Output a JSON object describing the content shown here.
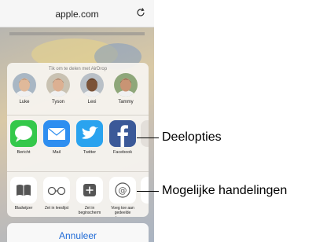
{
  "browser": {
    "url": "apple.com"
  },
  "share_sheet": {
    "airdrop_hint": "Tik om te delen met AirDrop",
    "people": [
      {
        "name": "Luke",
        "skin": "#e0b99a",
        "hair": "#6d4c36",
        "bg": "#a9b7c4"
      },
      {
        "name": "Tyson",
        "skin": "#dcb092",
        "hair": "#3c2e26",
        "bg": "#c9c2b2"
      },
      {
        "name": "Lexi",
        "skin": "#7b5338",
        "hair": "#1f1510",
        "bg": "#b9c0c7"
      },
      {
        "name": "Tammy",
        "skin": "#c99474",
        "hair": "#2c1d16",
        "bg": "#8fa77a"
      }
    ],
    "apps": [
      {
        "label": "Bericht",
        "icon": "messages-icon",
        "color": "#34c84a"
      },
      {
        "label": "Mail",
        "icon": "mail-icon",
        "color": "#2e8ef0"
      },
      {
        "label": "Twitter",
        "icon": "twitter-icon",
        "color": "#2aa3ef"
      },
      {
        "label": "Facebook",
        "icon": "facebook-icon",
        "color": "#3b5998"
      }
    ],
    "actions": [
      {
        "label": "Bladwijzer",
        "icon": "book-icon"
      },
      {
        "label": "Zet in leeslijst",
        "icon": "glasses-icon"
      },
      {
        "label": "Zet in beginscherm",
        "icon": "add-icon"
      },
      {
        "label": "Voeg toe aan gedeelde koppe...",
        "icon": "at-icon"
      }
    ],
    "cancel_label": "Annuleer"
  },
  "callouts": {
    "share_options": "Deelopties",
    "possible_actions": "Mogelijke handelingen"
  },
  "colors": {
    "accent": "#1f6ad6"
  }
}
